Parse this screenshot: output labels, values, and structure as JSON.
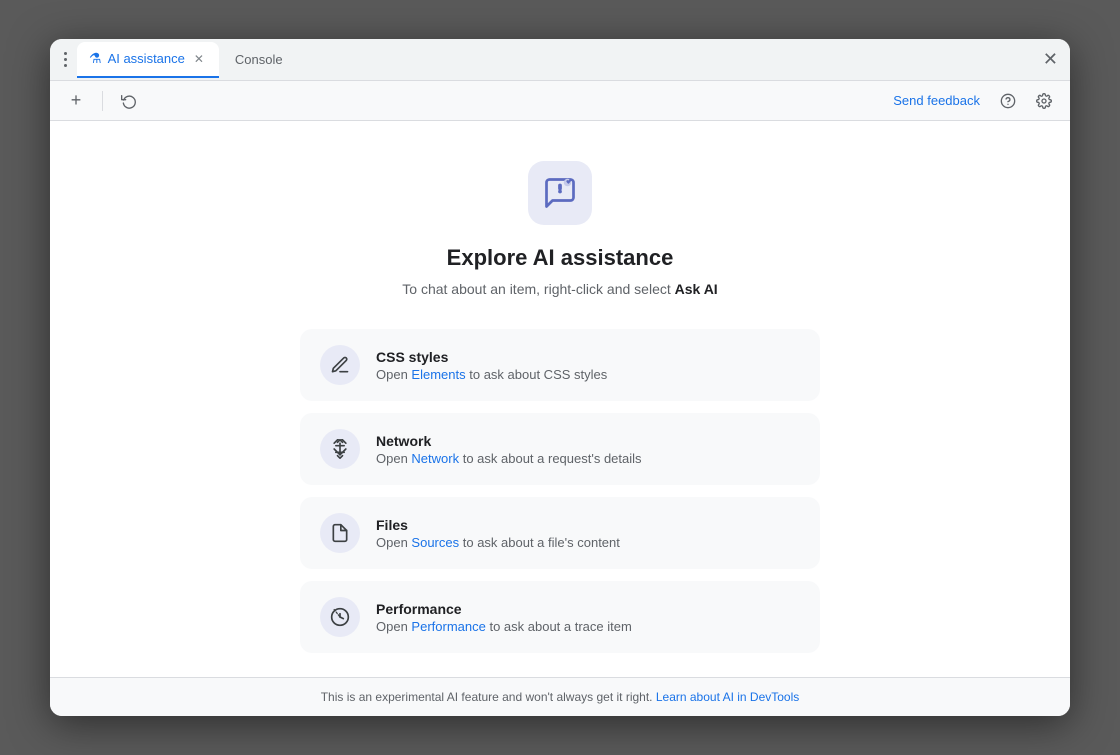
{
  "window": {
    "title": "AI assistance"
  },
  "tabs": [
    {
      "id": "ai-assistance",
      "label": "AI assistance",
      "icon": "⚗",
      "active": true,
      "closable": true
    },
    {
      "id": "console",
      "label": "Console",
      "active": false,
      "closable": false
    }
  ],
  "toolbar": {
    "send_feedback_label": "Send feedback",
    "history_icon": "⟲",
    "add_icon": "+",
    "help_icon": "?",
    "settings_icon": "⚙"
  },
  "main": {
    "icon_aria": "AI chat icon",
    "title": "Explore AI assistance",
    "subtitle_prefix": "To chat about an item, right-click and select ",
    "subtitle_highlight": "Ask AI",
    "features": [
      {
        "id": "css-styles",
        "title": "CSS styles",
        "desc_prefix": "Open ",
        "link_text": "Elements",
        "desc_suffix": " to ask about CSS styles",
        "icon": "pencil"
      },
      {
        "id": "network",
        "title": "Network",
        "desc_prefix": "Open ",
        "link_text": "Network",
        "desc_suffix": " to ask about a request's details",
        "icon": "arrows"
      },
      {
        "id": "files",
        "title": "Files",
        "desc_prefix": "Open ",
        "link_text": "Sources",
        "desc_suffix": " to ask about a file's content",
        "icon": "file"
      },
      {
        "id": "performance",
        "title": "Performance",
        "desc_prefix": "Open ",
        "link_text": "Performance",
        "desc_suffix": " to ask about a trace item",
        "icon": "gauge"
      }
    ]
  },
  "footer": {
    "text": "This is an experimental AI feature and won't always get it right. ",
    "link_text": "Learn about AI in DevTools",
    "link_href": "#"
  }
}
